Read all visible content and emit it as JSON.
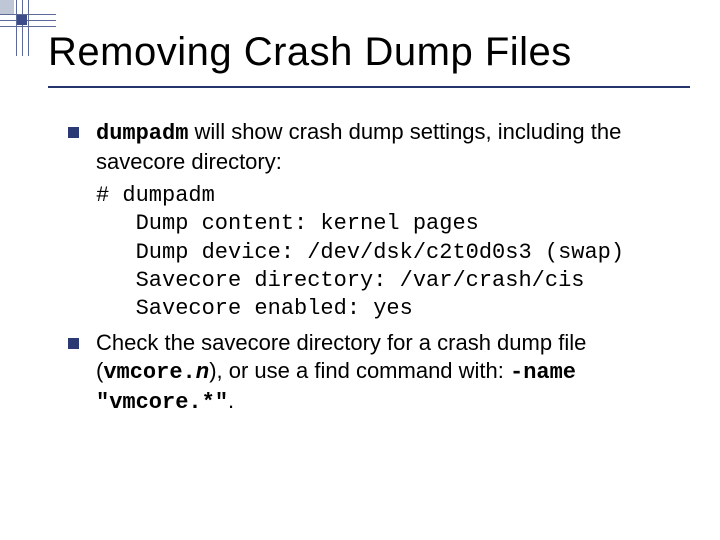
{
  "title": "Removing Crash Dump Files",
  "bullets": {
    "b1_pre": "dumpadm",
    "b1_post": " will show crash dump settings, including the savecore directory:",
    "b2_pre": "Check the savecore directory for a crash dump file (",
    "b2_file": "vmcore.",
    "b2_n": "n",
    "b2_mid": "), or use a find command with: ",
    "b2_flag": "-name \"vmcore.*\"",
    "b2_end": "."
  },
  "cmd": {
    "prompt": "# ",
    "command": "dumpadm",
    "l1": "Dump content: kernel pages",
    "l2": "Dump device: /dev/dsk/c2t0d0s3 (swap)",
    "l3": "Savecore directory: /var/crash/cis",
    "l4": "Savecore enabled: yes"
  }
}
